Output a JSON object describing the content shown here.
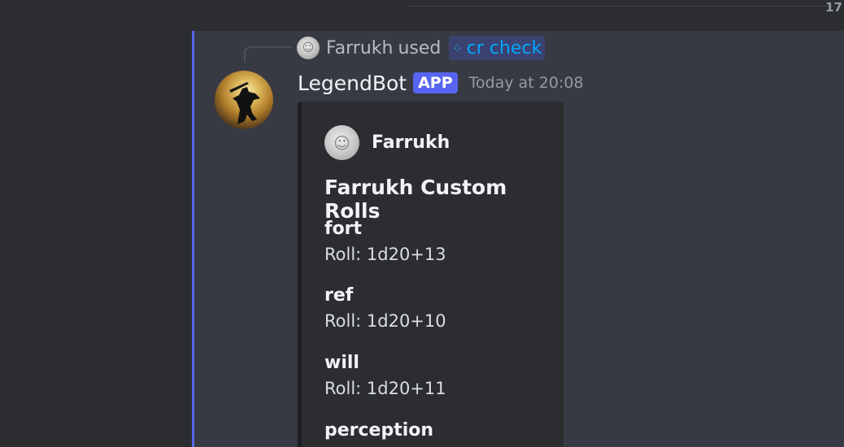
{
  "top": {
    "number": "17"
  },
  "reply": {
    "user": "Farrukh",
    "verb": "used",
    "command": "cr check"
  },
  "message": {
    "author": "LegendBot",
    "badge": "APP",
    "timestamp": "Today at 20:08"
  },
  "embed": {
    "author": "Farrukh",
    "title": "Farrukh Custom Rolls",
    "fields": [
      {
        "name": "fort",
        "value": "Roll: 1d20+13"
      },
      {
        "name": "ref",
        "value": "Roll: 1d20+10"
      },
      {
        "name": "will",
        "value": "Roll: 1d20+11"
      },
      {
        "name": "perception",
        "value": ""
      }
    ]
  },
  "colors": {
    "accent": "#5865f2",
    "command_link": "#00a8fc",
    "message_bg": "#383a43",
    "embed_bg": "#2b2d31"
  },
  "icons": {
    "command": "slash-command-icon",
    "reply_avatar": "user-avatar",
    "bot_avatar": "bot-avatar"
  }
}
